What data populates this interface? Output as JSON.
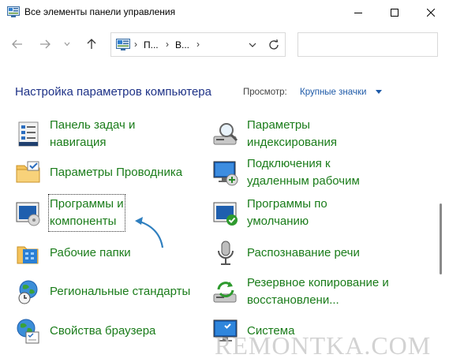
{
  "window": {
    "title": "Все элементы панели управления"
  },
  "nav": {
    "breadcrumbs": [
      "П...",
      "В..."
    ],
    "search_placeholder": ""
  },
  "header": {
    "title": "Настройка параметров компьютера",
    "view_label": "Просмотр:",
    "view_value": "Крупные значки"
  },
  "items": {
    "taskbar": {
      "line1": "Панель задач и",
      "line2": "навигация",
      "icon": "taskbar-icon"
    },
    "indexing": {
      "line1": "Параметры",
      "line2": "индексирования",
      "icon": "indexing-icon"
    },
    "explorer": {
      "label": "Параметры Проводника",
      "icon": "folder-options-icon"
    },
    "remote": {
      "line1": "Подключения к",
      "line2": "удаленным рабочим",
      "icon": "remote-desktop-icon"
    },
    "programs": {
      "line1": "Программы и",
      "line2": "компоненты",
      "icon": "programs-icon"
    },
    "defaults": {
      "line1": "Программы по",
      "line2": "умолчанию",
      "icon": "default-programs-icon"
    },
    "workfolders": {
      "label": "Рабочие папки",
      "icon": "work-folders-icon"
    },
    "speech": {
      "label": "Распознавание речи",
      "icon": "microphone-icon"
    },
    "regional": {
      "label": "Региональные стандарты",
      "icon": "regional-icon"
    },
    "backup": {
      "line1": "Резервное копирование и",
      "line2": "восстановлени...",
      "icon": "backup-icon"
    },
    "browser": {
      "label": "Свойства браузера",
      "icon": "internet-options-icon"
    },
    "system": {
      "label": "Система",
      "icon": "system-icon"
    }
  },
  "watermark": "REMONTKA.COM",
  "colors": {
    "link_green": "#1a7c1a",
    "title_blue": "#1e3287",
    "accent_blue": "#1e5aa8"
  }
}
